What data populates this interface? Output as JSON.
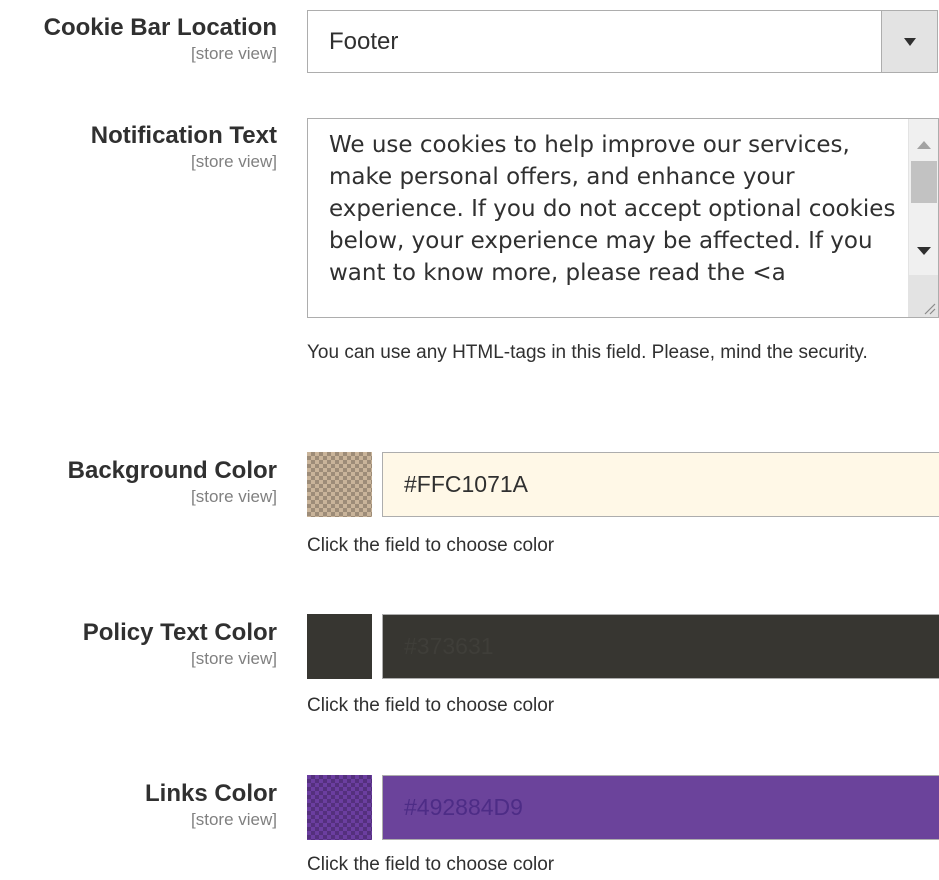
{
  "fields": {
    "cookie_bar_location": {
      "label": "Cookie Bar Location",
      "scope": "[store view]",
      "value": "Footer"
    },
    "notification_text": {
      "label": "Notification Text",
      "scope": "[store view]",
      "value": "We use cookies to help improve our services, make personal offers, and enhance your experience. If you do not accept optional cookies below, your experience may be affected. If you want to know more, please read the <a",
      "note": "You can use any HTML-tags in this field. Please, mind the security."
    },
    "background_color": {
      "label": "Background Color",
      "scope": "[store view]",
      "value": "#FFC1071A",
      "note": "Click the field to choose color",
      "swatch_color": "#c9b49a",
      "input_bg": "#fff8e7",
      "input_text": "#303030"
    },
    "policy_text_color": {
      "label": "Policy Text Color",
      "scope": "[store view]",
      "value": "#373631",
      "note": "Click the field to choose color",
      "swatch_color": "#373631",
      "input_bg": "#373631",
      "input_text": "#373631"
    },
    "links_color": {
      "label": "Links Color",
      "scope": "[store view]",
      "value": "#492884D9",
      "note": "Click the field to choose color",
      "swatch_color": "#6b3ea0",
      "input_bg": "#6b439b",
      "input_text": "#492884"
    }
  },
  "icons": {
    "select_arrow": "chevron-down-icon",
    "scroll_up": "triangle-up-icon",
    "scroll_down": "triangle-down-icon",
    "resize": "resize-grip-icon"
  }
}
